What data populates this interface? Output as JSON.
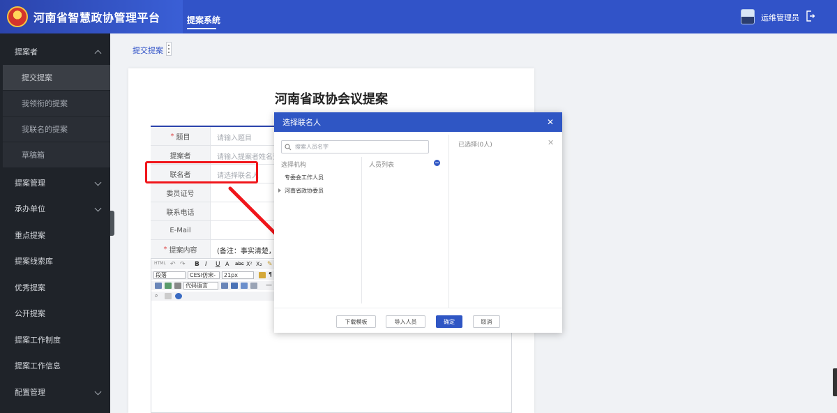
{
  "app": {
    "title": "河南省智慧政协管理平台",
    "nav_tab": "提案系统",
    "user_name": "运维管理员"
  },
  "colors": {
    "header": "#3153c8",
    "sidebar": "#1f2329",
    "accent": "#2f56c4",
    "highlight": "#f0161b"
  },
  "sidebar": {
    "items": [
      {
        "label": "提案者",
        "expanded": true
      },
      {
        "label": "提案管理"
      },
      {
        "label": "承办单位"
      },
      {
        "label": "重点提案"
      },
      {
        "label": "提案线索库"
      },
      {
        "label": "优秀提案"
      },
      {
        "label": "公开提案"
      },
      {
        "label": "提案工作制度"
      },
      {
        "label": "提案工作信息"
      },
      {
        "label": "配置管理"
      }
    ],
    "subitems": [
      {
        "label": "提交提案",
        "active": true
      },
      {
        "label": "我领衔的提案"
      },
      {
        "label": "我联名的提案"
      },
      {
        "label": "草稿箱"
      }
    ]
  },
  "breadcrumb": {
    "tab": "提交提案"
  },
  "document": {
    "title": "河南省政协会议提案",
    "fields": [
      {
        "label": "题目",
        "required": true,
        "value": "请输入题目"
      },
      {
        "label": "提案者",
        "required": false,
        "value": "请输入提案者姓名查"
      },
      {
        "label": "联名者",
        "required": false,
        "value": "请选择联名人"
      },
      {
        "label": "委员证号",
        "required": false,
        "value": ""
      },
      {
        "label": "联系电话",
        "required": false,
        "value": ""
      },
      {
        "label": "E-Mail",
        "required": false,
        "value": ""
      },
      {
        "label": "提案内容",
        "required": true,
        "value": "(备注：事实清楚，建议"
      }
    ],
    "editor": {
      "paragraph_select": "段落",
      "font_select": "CESI仿宋-",
      "size_select": "21px",
      "code_select": "代码语言"
    }
  },
  "modal": {
    "title": "选择联名人",
    "search_placeholder": "搜索人员名字",
    "org_heading": "选择机构",
    "orgs": [
      "专委会工作人员",
      "河南省政协委员"
    ],
    "people_heading": "人员列表",
    "selected_heading": "已选择(0人)",
    "buttons": {
      "download": "下载模板",
      "import": "导入人员",
      "confirm": "确定",
      "cancel": "取消"
    }
  }
}
